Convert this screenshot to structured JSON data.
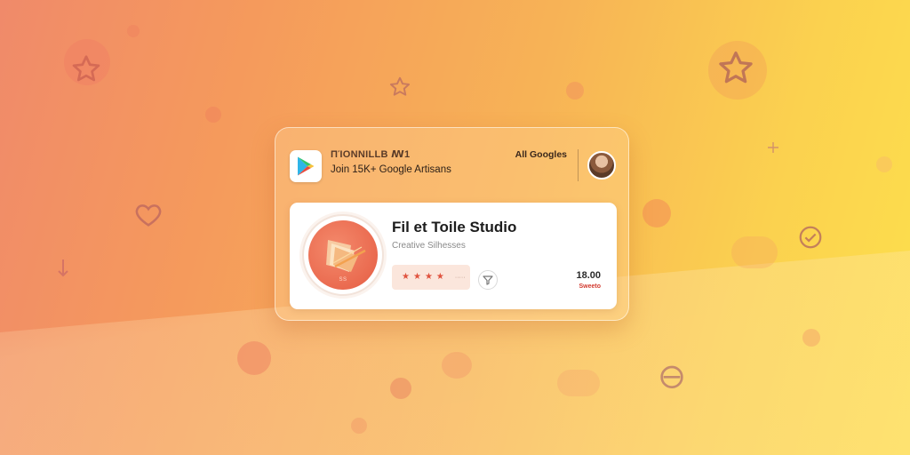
{
  "colors": {
    "bg_left": "#f08a6a",
    "bg_right": "#fde04c",
    "accent": "#e0533f",
    "card": "#ffffff"
  },
  "header": {
    "store_icon": "play-store-icon",
    "line1": "ΠΊONNILLΒ  ꟿ1",
    "line2": "Join 15K+ Google Artisans",
    "right_label": "All Googles"
  },
  "app": {
    "icon": "paper-swatch-icon",
    "icon_caption": "SS",
    "title": "Fil et Toile Studio",
    "subtitle": "Creative Silhesses",
    "rating": 4,
    "rating_stars": [
      "★",
      "★",
      "★",
      "★"
    ],
    "rating_count": "·····",
    "share_icon": "funnel-icon",
    "price": "18.00",
    "price_note": "Sweeto"
  },
  "decorations": [
    "star-outline-icon",
    "star-outline-icon",
    "heart-outline-icon",
    "check-circle-icon",
    "sparkle-star-icon",
    "circle-glyph-icon",
    "arrow-down-icon"
  ]
}
